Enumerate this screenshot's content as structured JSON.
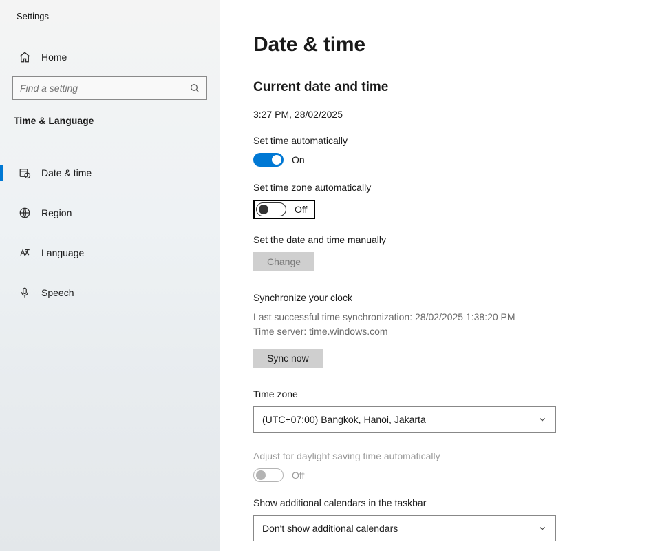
{
  "appTitle": "Settings",
  "sidebar": {
    "home": "Home",
    "searchPlaceholder": "Find a setting",
    "category": "Time & Language",
    "items": [
      {
        "label": "Date & time"
      },
      {
        "label": "Region"
      },
      {
        "label": "Language"
      },
      {
        "label": "Speech"
      }
    ]
  },
  "page": {
    "title": "Date & time",
    "currentHeading": "Current date and time",
    "currentValue": "3:27 PM, 28/02/2025",
    "setTimeAuto": {
      "label": "Set time automatically",
      "state": "On"
    },
    "setZoneAuto": {
      "label": "Set time zone automatically",
      "state": "Off"
    },
    "manual": {
      "label": "Set the date and time manually",
      "button": "Change"
    },
    "sync": {
      "heading": "Synchronize your clock",
      "lastLabel": "Last successful time synchronization:",
      "lastValue": "28/02/2025 1:38:20 PM",
      "serverLabel": "Time server:",
      "serverValue": "time.windows.com",
      "button": "Sync now"
    },
    "timezone": {
      "label": "Time zone",
      "value": "(UTC+07:00) Bangkok, Hanoi, Jakarta"
    },
    "dst": {
      "label": "Adjust for daylight saving time automatically",
      "state": "Off"
    },
    "addCal": {
      "label": "Show additional calendars in the taskbar",
      "value": "Don't show additional calendars"
    }
  }
}
